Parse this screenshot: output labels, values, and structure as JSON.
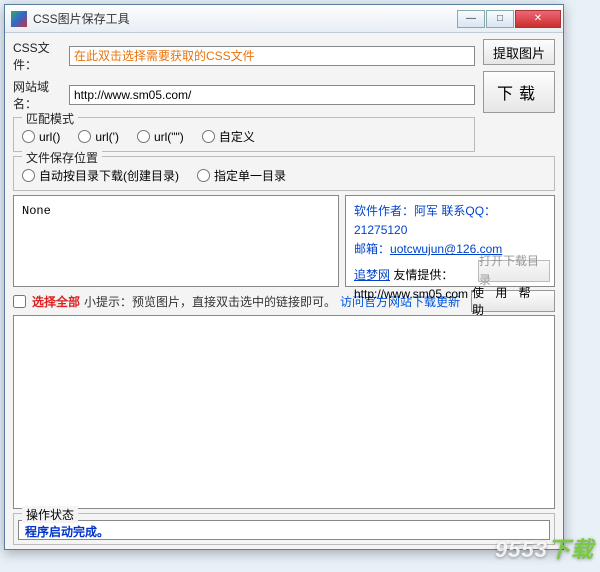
{
  "window": {
    "title": "CSS图片保存工具"
  },
  "fields": {
    "css_label": "CSS文件：",
    "css_placeholder": "在此双击选择需要获取的CSS文件",
    "domain_label": "网站域名：",
    "domain_value": "http://www.sm05.com/"
  },
  "buttons": {
    "extract": "提取图片",
    "download": "下载",
    "open_dir": "打开下载目录",
    "help": "使 用 帮 助"
  },
  "match": {
    "legend": "匹配模式",
    "opt1": "url()",
    "opt2": "url(')",
    "opt3": "url(\"\")",
    "opt4": "自定义"
  },
  "save": {
    "legend": "文件保存位置",
    "opt1": "自动按目录下载(创建目录)",
    "opt2": "指定单一目录"
  },
  "list": {
    "content": "None"
  },
  "info": {
    "author_label": "软件作者：",
    "author": "阿军",
    "qq_label": "联系QQ：",
    "qq": "21275120",
    "mail_label": "邮箱：",
    "mail": "uotcwujun@126.com",
    "site_label": "追梦网",
    "site_suffix": "友情提供：",
    "site_url": "http://www.sm05.com"
  },
  "selrow": {
    "selectall": "选择全部",
    "tip": "小提示：预览图片，直接双击选中的链接即可。",
    "update": "访问官方网站下载更新"
  },
  "status": {
    "legend": "操作状态",
    "text": "程序启动完成。"
  },
  "watermark": {
    "a": "9553",
    "b": "下载"
  }
}
